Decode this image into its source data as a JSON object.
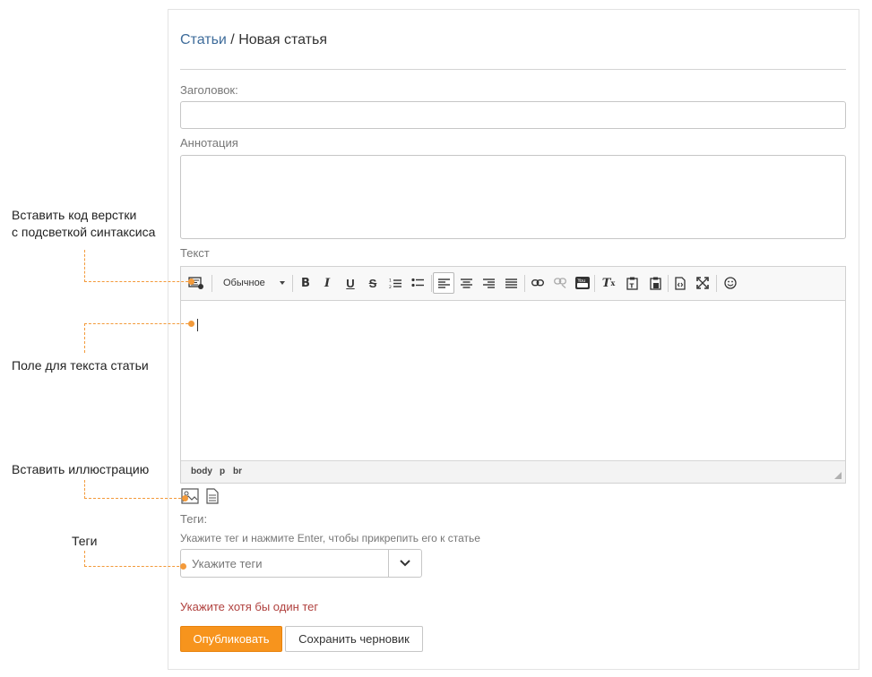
{
  "breadcrumb": {
    "link": "Статьи",
    "separator": " / ",
    "current": "Новая статья"
  },
  "form": {
    "title_label": "Заголовок:",
    "title_value": "",
    "annotation_label": "Аннотация",
    "annotation_value": "",
    "text_label": "Текст",
    "format_select": "Обычное",
    "status_path": [
      "body",
      "p",
      "br"
    ],
    "tags_label": "Теги:",
    "tags_hint": "Укажите тег и нажмите Enter, чтобы прикрепить его к статье",
    "tags_placeholder": "Укажите теги",
    "error": "Укажите хотя бы один тег",
    "publish": "Опубликовать",
    "save_draft": "Сохранить черновик"
  },
  "toolbar_icons": [
    "code-snippet-icon",
    "bold-icon",
    "italic-icon",
    "underline-icon",
    "strikethrough-icon",
    "numbered-list-icon",
    "bulleted-list-icon",
    "align-left-icon",
    "align-center-icon",
    "align-right-icon",
    "justify-icon",
    "link-icon",
    "unlink-icon",
    "youtube-icon",
    "remove-format-icon",
    "paste-text-icon",
    "paste-word-icon",
    "source-icon",
    "maximize-icon",
    "smiley-icon"
  ],
  "annotations": {
    "code": [
      "Вставить код верстки",
      "с подсветкой синтаксиса"
    ],
    "field": "Поле для текста статьи",
    "image": "Вставить иллюстрацию",
    "tags": "Теги"
  },
  "colors": {
    "accent": "#f7941d",
    "link": "#3d6b9a",
    "error": "#b0413e",
    "annotation_line": "#f39a3a"
  }
}
